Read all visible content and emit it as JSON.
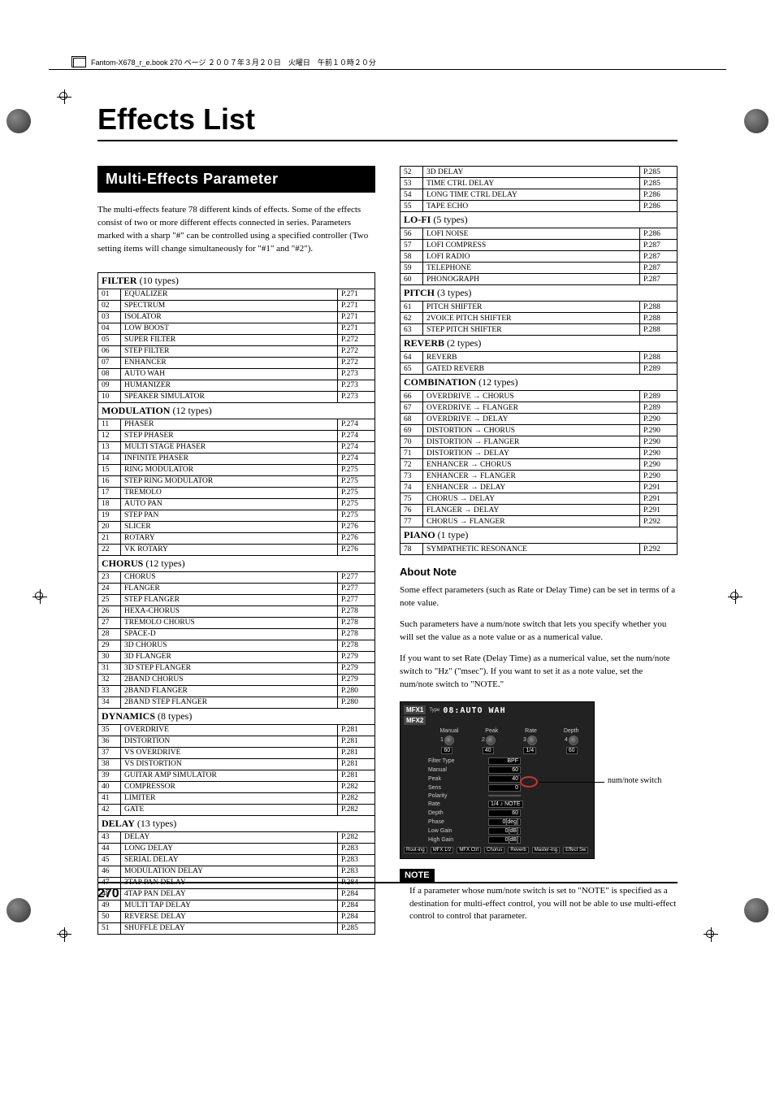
{
  "header_stamp": "Fantom-X678_r_e.book 270 ページ ２００７年３月２０日　火曜日　午前１０時２０分",
  "page_title": "Effects List",
  "section_title": "Multi-Effects Parameter",
  "intro": "The multi-effects feature 78 different kinds of effects. Some of the effects consist of two or more different effects connected in series. Parameters marked with a sharp \"#\" can be controlled using a specified controller (Two setting items will change simultaneously for \"#1\" and \"#2\").",
  "sections": [
    {
      "heading": "FILTER",
      "count": "(10 types)",
      "rows": [
        [
          "01",
          "EQUALIZER",
          "P.271"
        ],
        [
          "02",
          "SPECTRUM",
          "P.271"
        ],
        [
          "03",
          "ISOLATOR",
          "P.271"
        ],
        [
          "04",
          "LOW BOOST",
          "P.271"
        ],
        [
          "05",
          "SUPER FILTER",
          "P.272"
        ],
        [
          "06",
          "STEP FILTER",
          "P.272"
        ],
        [
          "07",
          "ENHANCER",
          "P.272"
        ],
        [
          "08",
          "AUTO WAH",
          "P.273"
        ],
        [
          "09",
          "HUMANIZER",
          "P.273"
        ],
        [
          "10",
          "SPEAKER SIMULATOR",
          "P.273"
        ]
      ]
    },
    {
      "heading": "MODULATION",
      "count": "(12 types)",
      "rows": [
        [
          "11",
          "PHASER",
          "P.274"
        ],
        [
          "12",
          "STEP PHASER",
          "P.274"
        ],
        [
          "13",
          "MULTI STAGE PHASER",
          "P.274"
        ],
        [
          "14",
          "INFINITE PHASER",
          "P.274"
        ],
        [
          "15",
          "RING MODULATOR",
          "P.275"
        ],
        [
          "16",
          "STEP RING MODULATOR",
          "P.275"
        ],
        [
          "17",
          "TREMOLO",
          "P.275"
        ],
        [
          "18",
          "AUTO PAN",
          "P.275"
        ],
        [
          "19",
          "STEP PAN",
          "P.275"
        ],
        [
          "20",
          "SLICER",
          "P.276"
        ],
        [
          "21",
          "ROTARY",
          "P.276"
        ],
        [
          "22",
          "VK ROTARY",
          "P.276"
        ]
      ]
    },
    {
      "heading": "CHORUS",
      "count": "(12 types)",
      "rows": [
        [
          "23",
          "CHORUS",
          "P.277"
        ],
        [
          "24",
          "FLANGER",
          "P.277"
        ],
        [
          "25",
          "STEP FLANGER",
          "P.277"
        ],
        [
          "26",
          "HEXA-CHORUS",
          "P.278"
        ],
        [
          "27",
          "TREMOLO CHORUS",
          "P.278"
        ],
        [
          "28",
          "SPACE-D",
          "P.278"
        ],
        [
          "29",
          "3D CHORUS",
          "P.278"
        ],
        [
          "30",
          "3D FLANGER",
          "P.279"
        ],
        [
          "31",
          "3D STEP FLANGER",
          "P.279"
        ],
        [
          "32",
          "2BAND CHORUS",
          "P.279"
        ],
        [
          "33",
          "2BAND FLANGER",
          "P.280"
        ],
        [
          "34",
          "2BAND STEP FLANGER",
          "P.280"
        ]
      ]
    },
    {
      "heading": "DYNAMICS",
      "count": "(8 types)",
      "rows": [
        [
          "35",
          "OVERDRIVE",
          "P.281"
        ],
        [
          "36",
          "DISTORTION",
          "P.281"
        ],
        [
          "37",
          "VS OVERDRIVE",
          "P.281"
        ],
        [
          "38",
          "VS DISTORTION",
          "P.281"
        ],
        [
          "39",
          "GUITAR AMP SIMULATOR",
          "P.281"
        ],
        [
          "40",
          "COMPRESSOR",
          "P.282"
        ],
        [
          "41",
          "LIMITER",
          "P.282"
        ],
        [
          "42",
          "GATE",
          "P.282"
        ]
      ]
    },
    {
      "heading": "DELAY",
      "count": "(13 types)",
      "rows": [
        [
          "43",
          "DELAY",
          "P.282"
        ],
        [
          "44",
          "LONG DELAY",
          "P.283"
        ],
        [
          "45",
          "SERIAL DELAY",
          "P.283"
        ],
        [
          "46",
          "MODULATION DELAY",
          "P.283"
        ],
        [
          "47",
          "3TAP PAN DELAY",
          "P.284"
        ],
        [
          "48",
          "4TAP PAN DELAY",
          "P.284"
        ],
        [
          "49",
          "MULTI TAP DELAY",
          "P.284"
        ],
        [
          "50",
          "REVERSE DELAY",
          "P.284"
        ],
        [
          "51",
          "SHUFFLE DELAY",
          "P.285"
        ]
      ]
    }
  ],
  "sections2": [
    {
      "rows": [
        [
          "52",
          "3D DELAY",
          "P.285"
        ],
        [
          "53",
          "TIME CTRL DELAY",
          "P.285"
        ],
        [
          "54",
          "LONG TIME CTRL DELAY",
          "P.286"
        ],
        [
          "55",
          "TAPE ECHO",
          "P.286"
        ]
      ]
    },
    {
      "heading": "LO-FI",
      "count": "(5 types)",
      "rows": [
        [
          "56",
          "LOFI NOISE",
          "P.286"
        ],
        [
          "57",
          "LOFI COMPRESS",
          "P.287"
        ],
        [
          "58",
          "LOFI RADIO",
          "P.287"
        ],
        [
          "59",
          "TELEPHONE",
          "P.287"
        ],
        [
          "60",
          "PHONOGRAPH",
          "P.287"
        ]
      ]
    },
    {
      "heading": "PITCH",
      "count": "(3 types)",
      "rows": [
        [
          "61",
          "PITCH SHIFTER",
          "P.288"
        ],
        [
          "62",
          "2VOICE PITCH SHIFTER",
          "P.288"
        ],
        [
          "63",
          "STEP PITCH SHIFTER",
          "P.288"
        ]
      ]
    },
    {
      "heading": "REVERB",
      "count": "(2 types)",
      "rows": [
        [
          "64",
          "REVERB",
          "P.288"
        ],
        [
          "65",
          "GATED REVERB",
          "P.289"
        ]
      ]
    },
    {
      "heading": "COMBINATION",
      "count": "(12 types)",
      "rows": [
        [
          "66",
          "OVERDRIVE → CHORUS",
          "P.289"
        ],
        [
          "67",
          "OVERDRIVE → FLANGER",
          "P.289"
        ],
        [
          "68",
          "OVERDRIVE → DELAY",
          "P.290"
        ],
        [
          "69",
          "DISTORTION → CHORUS",
          "P.290"
        ],
        [
          "70",
          "DISTORTION → FLANGER",
          "P.290"
        ],
        [
          "71",
          "DISTORTION → DELAY",
          "P.290"
        ],
        [
          "72",
          "ENHANCER → CHORUS",
          "P.290"
        ],
        [
          "73",
          "ENHANCER → FLANGER",
          "P.290"
        ],
        [
          "74",
          "ENHANCER → DELAY",
          "P.291"
        ],
        [
          "75",
          "CHORUS → DELAY",
          "P.291"
        ],
        [
          "76",
          "FLANGER → DELAY",
          "P.291"
        ],
        [
          "77",
          "CHORUS → FLANGER",
          "P.292"
        ]
      ]
    },
    {
      "heading": "PIANO",
      "count": "(1 type)",
      "rows": [
        [
          "78",
          "SYMPATHETIC RESONANCE",
          "P.292"
        ]
      ]
    }
  ],
  "about_heading": "About Note",
  "about_paragraphs": [
    "Some effect parameters (such as Rate or Delay Time) can be set in terms of a note value.",
    "Such parameters have a num/note switch that lets you specify whether you will set the value as a note value or as a numerical value.",
    "If you want to set Rate (Delay Time) as a numerical value, set the num/note switch to \"Hz\" (\"msec\"). If you want to set it as a note value, set the num/note switch to \"NOTE.\""
  ],
  "callout": "num/note switch",
  "note_label": "NOTE",
  "note_text": "If a parameter whose num/note switch is set to \"NOTE\" is specified as a destination for multi-effect control, you will not be able to use multi-effect control to control that parameter.",
  "mfx": {
    "tab1": "MFX1",
    "tab2": "MFX2",
    "title": "08:AUTO WAH",
    "labels": [
      "Manual",
      "Peak",
      "Rate",
      "Depth"
    ],
    "nums": [
      "1",
      "2",
      "3",
      "4"
    ],
    "vals": [
      "60",
      "40",
      "1/4",
      "60"
    ],
    "params": [
      [
        "Filter Type",
        "BPF"
      ],
      [
        "Manual",
        "60"
      ],
      [
        "Peak",
        "40"
      ],
      [
        "Sens",
        "0"
      ],
      [
        "Polarity",
        ""
      ],
      [
        "Rate",
        "1/4   ♪   NOTE"
      ],
      [
        "Depth",
        "60"
      ],
      [
        "Phase",
        "0[deg]"
      ],
      [
        "Low Gain",
        "0[dB]"
      ],
      [
        "High Gain",
        "0[dB]"
      ]
    ],
    "footer": [
      "Rout-ing",
      "MFX 1/2",
      "MFX Ctrl",
      "Chorus",
      "Reverb",
      "Master-ing",
      "Effect Sw"
    ]
  },
  "page_number": "270"
}
